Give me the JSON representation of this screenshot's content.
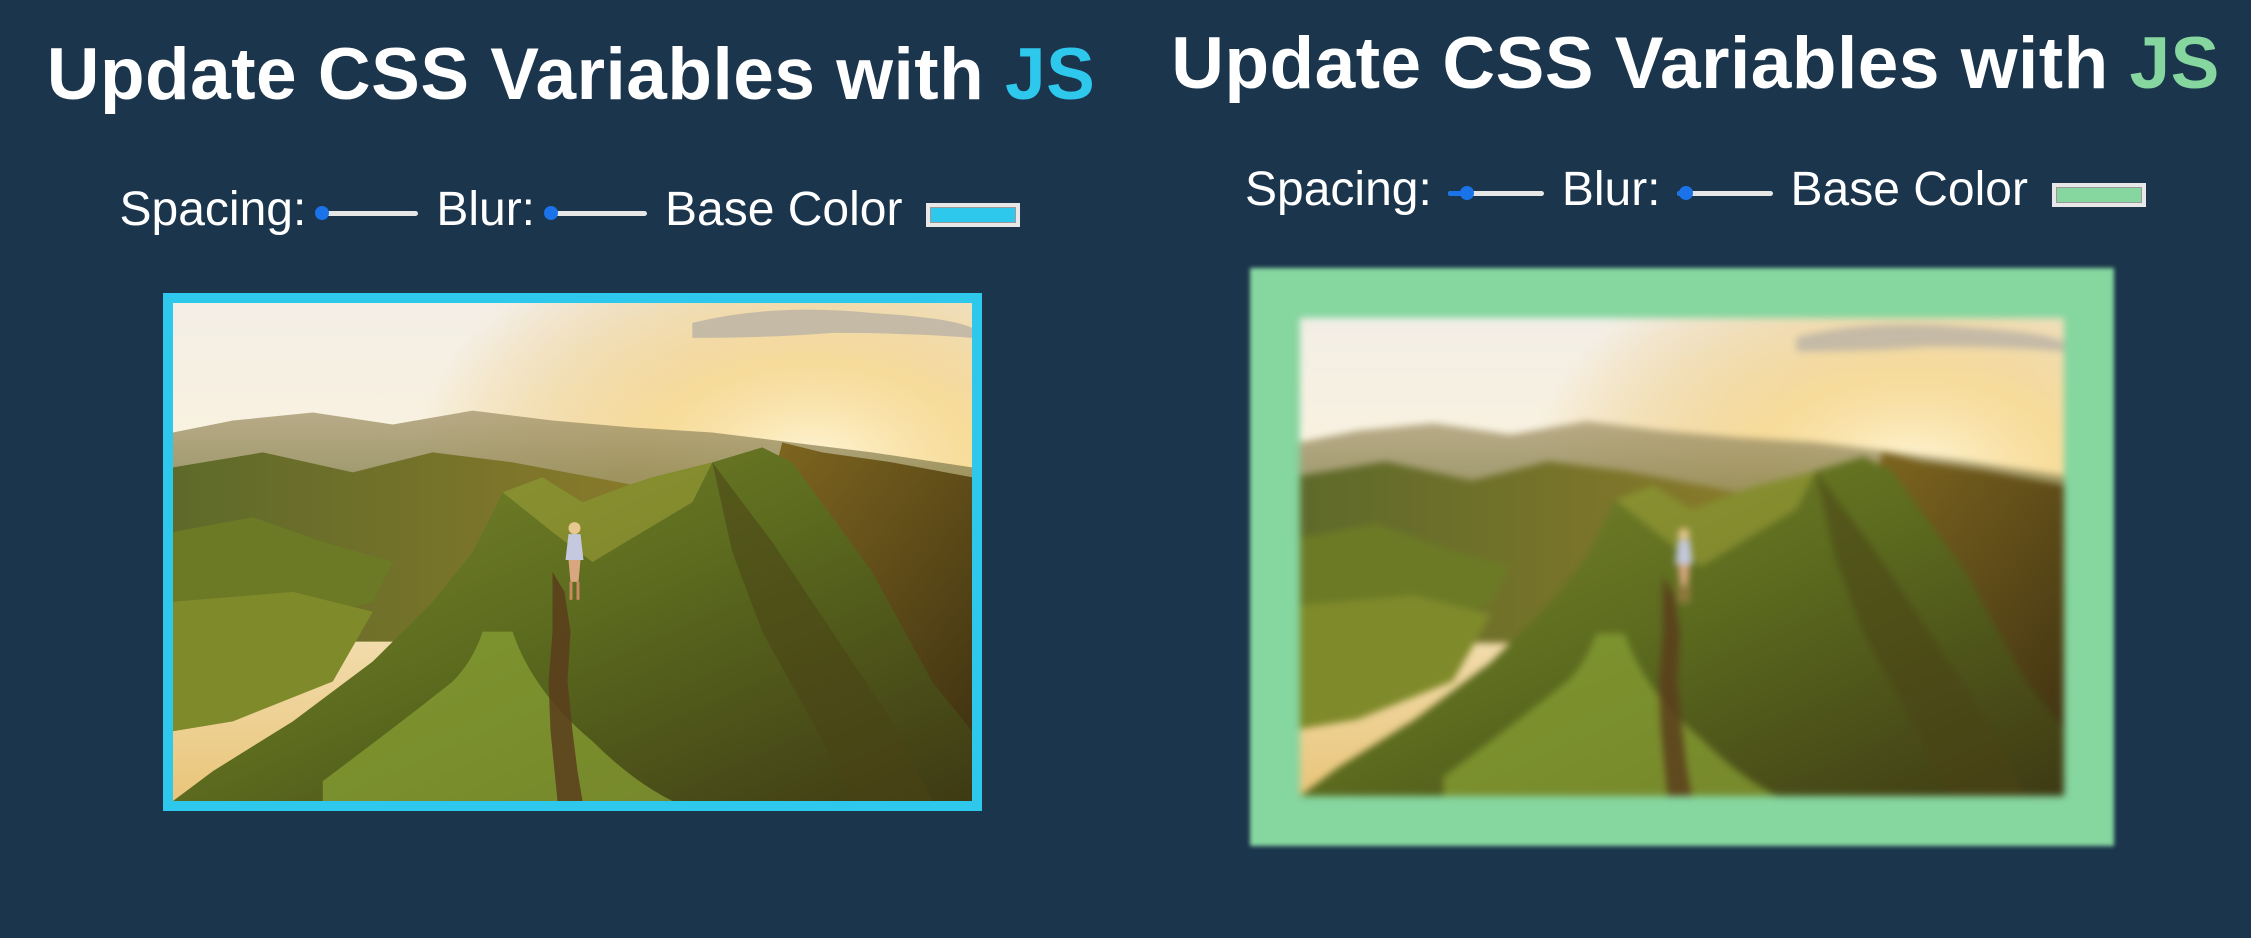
{
  "panels": [
    {
      "title": {
        "main": "Update CSS Variables with ",
        "accent": "JS"
      },
      "controls": {
        "spacing_label": "Spacing:",
        "blur_label": "Blur:",
        "base_color_label": "Base Color",
        "spacing_value": 0,
        "blur_value": 0,
        "base_color": "#2ec8ed"
      },
      "image": {
        "subject": "hiker-on-mountain-ridge-at-sunset"
      }
    },
    {
      "title": {
        "main": "Update CSS Variables with ",
        "accent": "JS"
      },
      "controls": {
        "spacing_label": "Spacing:",
        "blur_label": "Blur:",
        "base_color_label": "Base Color",
        "spacing_value": 0.2,
        "blur_value": 0.1,
        "base_color": "#86d6a0"
      },
      "image": {
        "subject": "hiker-on-mountain-ridge-at-sunset"
      }
    }
  ],
  "colors": {
    "background": "#1b354c",
    "slider_accent": "#1a73e8",
    "text": "#ffffff"
  }
}
